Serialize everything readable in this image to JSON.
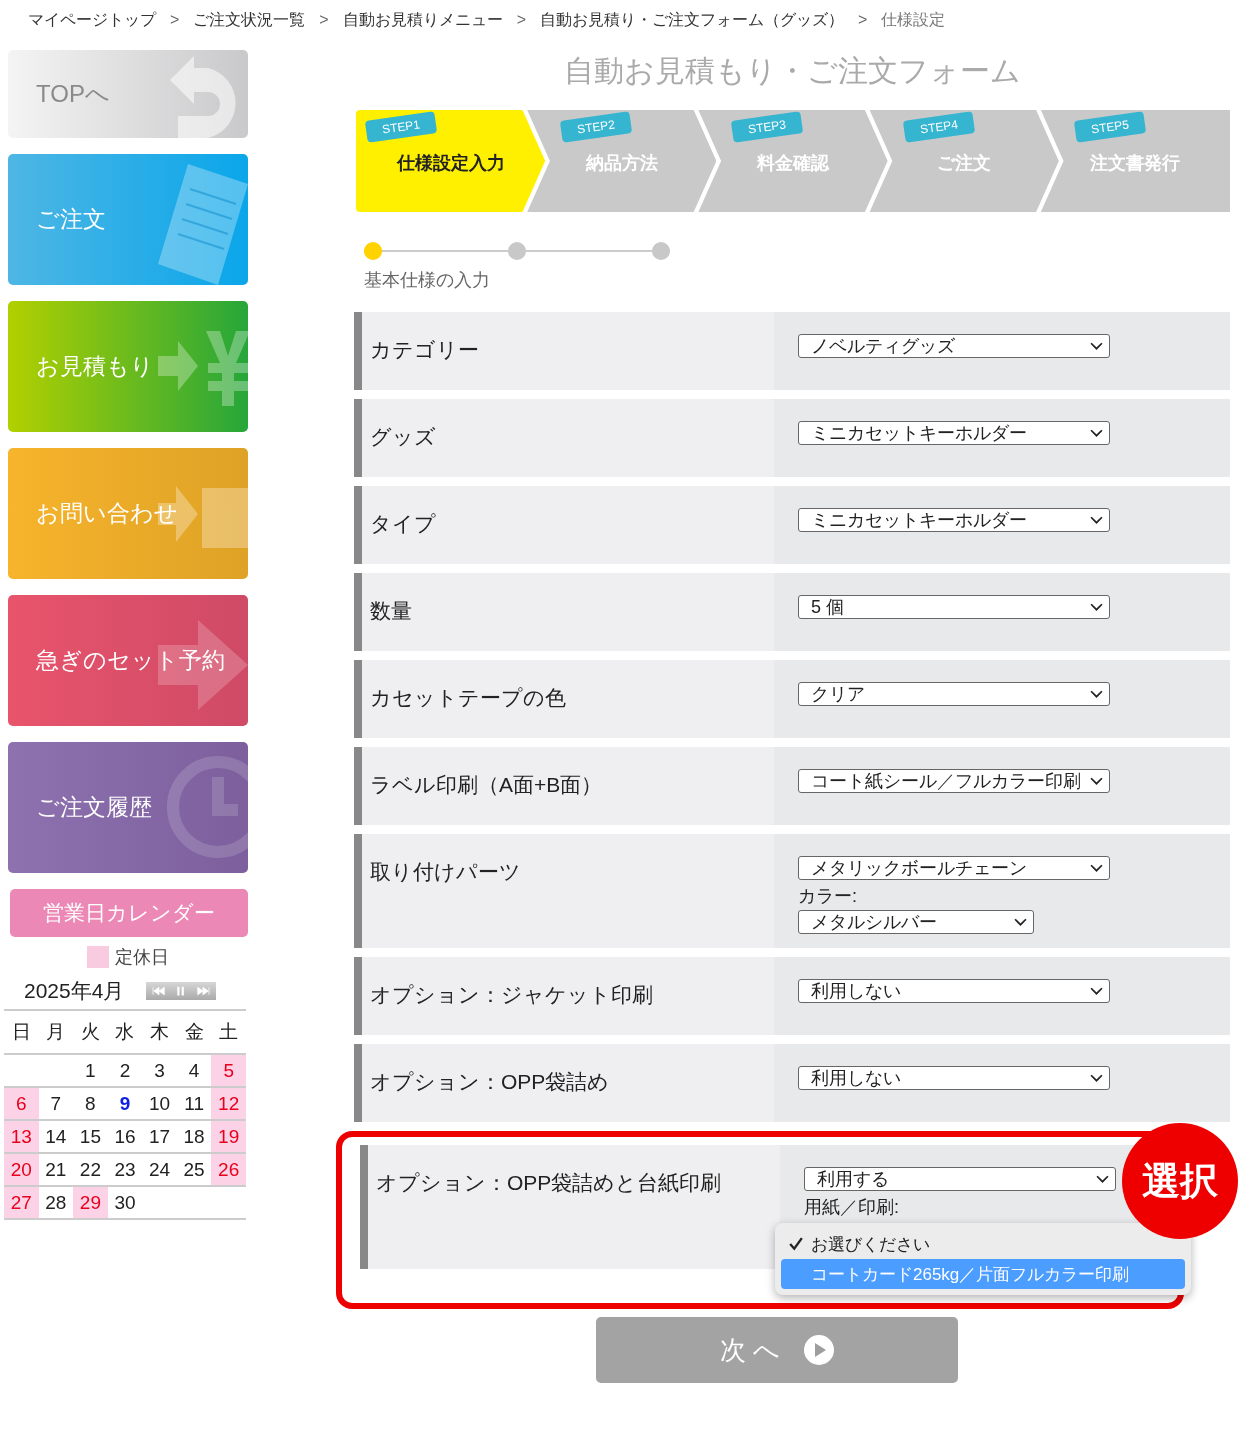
{
  "breadcrumb": [
    {
      "label": "マイページトップ"
    },
    {
      "label": "ご注文状況一覧"
    },
    {
      "label": "自動お見積りメニュー"
    },
    {
      "label": "自動お見積り・ご注文フォーム（グッズ）"
    },
    {
      "label": "仕様設定"
    }
  ],
  "breadcrumb_separator": ">",
  "sidebar": {
    "items": [
      {
        "label": "TOPへ",
        "kind": "top"
      },
      {
        "label": "ご注文",
        "kind": "order"
      },
      {
        "label": "お見積もり",
        "kind": "estimate"
      },
      {
        "label": "お問い合わせ",
        "kind": "contact"
      },
      {
        "label": "急ぎのセット予約",
        "kind": "rush"
      },
      {
        "label": "ご注文履歴",
        "kind": "history"
      }
    ],
    "calendar": {
      "title": "営業日カレンダー",
      "legend": "定休日",
      "month": "2025年4月",
      "weekdays": [
        "日",
        "月",
        "火",
        "水",
        "木",
        "金",
        "土"
      ],
      "weeks": [
        [
          {
            "kind": "empty"
          },
          {
            "kind": "empty"
          },
          {
            "day": "1",
            "kind": "open"
          },
          {
            "day": "2",
            "kind": "open"
          },
          {
            "day": "3",
            "kind": "open"
          },
          {
            "day": "4",
            "kind": "open"
          },
          {
            "day": "5",
            "kind": "closed"
          }
        ],
        [
          {
            "day": "6",
            "kind": "closed"
          },
          {
            "day": "7",
            "kind": "open"
          },
          {
            "day": "8",
            "kind": "open"
          },
          {
            "day": "9",
            "kind": "today"
          },
          {
            "day": "10",
            "kind": "open"
          },
          {
            "day": "11",
            "kind": "open"
          },
          {
            "day": "12",
            "kind": "closed"
          }
        ],
        [
          {
            "day": "13",
            "kind": "closed"
          },
          {
            "day": "14",
            "kind": "open"
          },
          {
            "day": "15",
            "kind": "open"
          },
          {
            "day": "16",
            "kind": "open"
          },
          {
            "day": "17",
            "kind": "open"
          },
          {
            "day": "18",
            "kind": "open"
          },
          {
            "day": "19",
            "kind": "closed"
          }
        ],
        [
          {
            "day": "20",
            "kind": "closed"
          },
          {
            "day": "21",
            "kind": "open"
          },
          {
            "day": "22",
            "kind": "open"
          },
          {
            "day": "23",
            "kind": "open"
          },
          {
            "day": "24",
            "kind": "open"
          },
          {
            "day": "25",
            "kind": "open"
          },
          {
            "day": "26",
            "kind": "closed"
          }
        ],
        [
          {
            "day": "27",
            "kind": "closed"
          },
          {
            "day": "28",
            "kind": "open"
          },
          {
            "day": "29",
            "kind": "closed"
          },
          {
            "day": "30",
            "kind": "open"
          },
          {
            "kind": "empty"
          },
          {
            "kind": "empty"
          },
          {
            "kind": "empty"
          }
        ]
      ]
    }
  },
  "title": "自動お見積もり・ご注文フォーム",
  "steps": [
    {
      "badge": "STEP1",
      "label": "仕様設定入力",
      "selected": true
    },
    {
      "badge": "STEP2",
      "label": "納品方法",
      "selected": false
    },
    {
      "badge": "STEP3",
      "label": "料金確認",
      "selected": false
    },
    {
      "badge": "STEP4",
      "label": "ご注文",
      "selected": false
    },
    {
      "badge": "STEP5",
      "label": "注文書発行",
      "selected": false
    }
  ],
  "progress": {
    "dots": [
      {
        "selected": true
      },
      {
        "selected": false
      },
      {
        "selected": false
      }
    ],
    "label": "基本仕様の入力"
  },
  "form": [
    {
      "label": "カテゴリー",
      "value": "ノベルティグッズ"
    },
    {
      "label": "グッズ",
      "value": "ミニカセットキーホルダー"
    },
    {
      "label": "タイプ",
      "value": "ミニカセットキーホルダー"
    },
    {
      "label": "数量",
      "value": "5 個"
    },
    {
      "label": "カセットテープの色",
      "value": "クリア"
    },
    {
      "label": "ラベル印刷（A面+B面）",
      "value": "コート紙シール／フルカラー印刷"
    },
    {
      "label": "取り付けパーツ",
      "value": "メタリックボールチェーン",
      "sub_label": "カラー:",
      "sub_value": "メタルシルバー"
    },
    {
      "label": "オプション：ジャケット印刷",
      "value": "利用しない"
    },
    {
      "label": "オプション：OPP袋詰め",
      "value": "利用しない"
    },
    {
      "label": "オプション：OPP袋詰めと台紙印刷",
      "value": "利用する",
      "sub_label": "用紙／印刷:",
      "highlighted": true,
      "menu": [
        {
          "label": "お選びください",
          "checked": true,
          "selected": false
        },
        {
          "label": "コートカード265kg／片面フルカラー印刷",
          "checked": false,
          "selected": true
        }
      ]
    }
  ],
  "callout": "選択",
  "next_button": {
    "label": "次 へ"
  }
}
